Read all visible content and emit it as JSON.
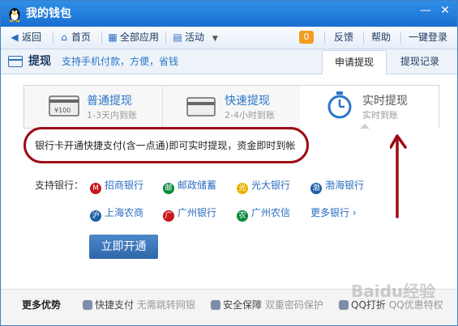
{
  "window": {
    "title": "我的钱包",
    "controls": [
      "—",
      "✕"
    ]
  },
  "nav": {
    "back": "返回",
    "home": "首页",
    "all_apps": "全部应用",
    "activities": "活动",
    "badge_count": "0",
    "feedback": "反馈",
    "help": "帮助",
    "login": "一键登录"
  },
  "subheader": {
    "title": "提现",
    "slogan": "支持手机付款，方便，省钱"
  },
  "tabs": [
    {
      "label": "申请提现",
      "active": true
    },
    {
      "label": "提现记录",
      "active": false
    }
  ],
  "methods": [
    {
      "title": "普通提现",
      "subtitle": "1-3天内到账",
      "icon_text": "¥100"
    },
    {
      "title": "快速提现",
      "subtitle": "2-4小时到账"
    },
    {
      "title": "实时提现",
      "subtitle": "实时到账",
      "selected": true
    }
  ],
  "notice": "银行卡开通快捷支付(含一点通)即可实时提现，资金即时到帐",
  "banks": {
    "label": "支持银行：",
    "items": [
      {
        "name": "招商银行",
        "color": "#c8161d"
      },
      {
        "name": "邮政储蓄",
        "color": "#0a8a3c"
      },
      {
        "name": "光大银行",
        "color": "#e8b400"
      },
      {
        "name": "渤海银行",
        "color": "#1f5fa8"
      },
      {
        "name": "上海农商",
        "color": "#1f5fa8"
      },
      {
        "name": "广州银行",
        "color": "#c8161d"
      },
      {
        "name": "广州农信",
        "color": "#0a8a3c"
      }
    ],
    "more": "更多银行 ›"
  },
  "open_button": "立即开通",
  "bottom": {
    "title": "更多优势",
    "items": [
      {
        "label": "快捷支付",
        "detail": "无需跳转网银"
      },
      {
        "label": "安全保障",
        "detail": "双重密码保护"
      },
      {
        "label": "QQ打折",
        "detail": "QQ优惠特权"
      }
    ]
  },
  "watermark": "Baidu经验",
  "colors": {
    "titlebar": "#1a6fd1",
    "link": "#2a76c8",
    "button": "#2e66aa",
    "annotation": "#9d0a14",
    "badge": "#f29c1f"
  }
}
